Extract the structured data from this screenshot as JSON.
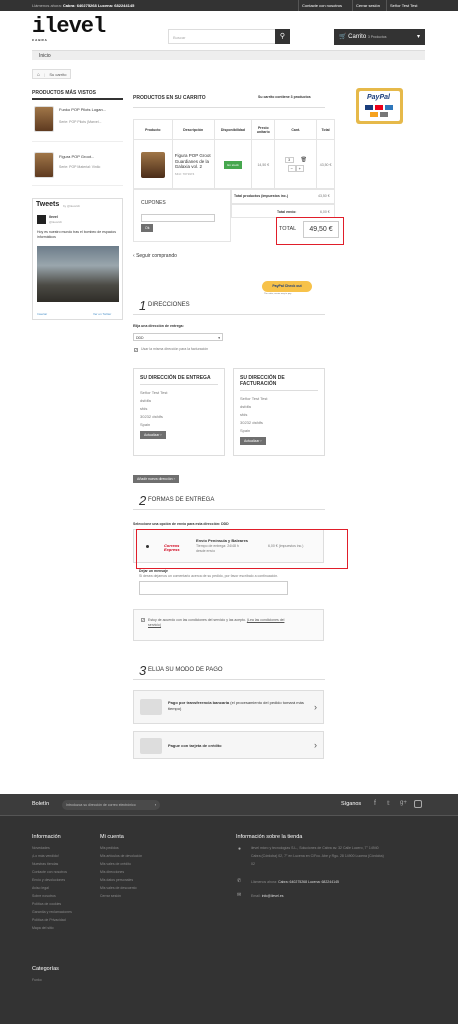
{
  "topbar": {
    "call_prefix": "Llámenos ahora:",
    "call_numbers": "Cabra: 640275268 Lucena: 682244145",
    "links": [
      "Contacte con nosotros",
      "Cerrar sesión",
      "Señor Test Test"
    ]
  },
  "header": {
    "logo_text": "ilevel",
    "logo_sub": "CABRA",
    "search_placeholder": "Buscar",
    "cart_label": "Carrito",
    "cart_count": "3 Productos"
  },
  "nav": {
    "home": "Inicio"
  },
  "breadcrumb": {
    "current": "Su carrito"
  },
  "sidebar": {
    "viewed_title": "PRODUCTOS MÁS VISTOS",
    "products": [
      {
        "name": "Funko POP Pilots Logan...",
        "desc": "Serie: POP Pilots (Marvel..."
      },
      {
        "name": "Figura POP Groot...",
        "desc": "Serie: POP Material: Vinilo"
      }
    ],
    "tweets": {
      "title": "Tweets",
      "by": "by @ilevelcb",
      "user": "ilevel",
      "handle": "@ilevelcb",
      "text": "Hoy es nuestro mundo tras el bombeo de espacios informáticos",
      "embed": "Insertar",
      "view_on": "Ver en Twitter"
    }
  },
  "cart": {
    "title": "PRODUCTOS EN SU CARRITO",
    "summary": "Su carrito contiene 3 productos",
    "headers": [
      "Producto",
      "Descripción",
      "Disponibilidad",
      "Precio unitario",
      "Cant.",
      "Total"
    ],
    "item": {
      "name": "Figura POP Groot Guardianes de la Galaxia vol. 2",
      "ref": "SKU: 7071974",
      "availability": "En stock",
      "unit_price": "14,50 €",
      "qty": "3",
      "total": "43,50 €"
    },
    "vouchers_label": "CUPONES",
    "voucher_btn": "Ok",
    "total_products_label": "Total productos (impuestos inc.)",
    "total_products": "43,50 €",
    "shipping_label": "Total envío:",
    "shipping": "6,00 €",
    "total_label": "TOTAL",
    "total": "49,50 €",
    "continue": "Seguir comprando",
    "paypal_checkout": "PayPal Check out",
    "paypal_sub": "The safer, easier way to pay"
  },
  "addresses": {
    "num": "1",
    "title": "DIRECCIONES",
    "select_label": "Elija una dirección de entrega:",
    "select_value": "DDD",
    "same_label": "Usar la misma dirección para la facturación",
    "delivery_title": "SU DIRECCIÓN DE ENTREGA",
    "billing_title": "SU DIRECCIÓN DE FACTURACIÓN",
    "lines": [
      "Señor Test Test",
      "dsfdfa",
      "sfds",
      "30232 dsfdfs",
      "Spain"
    ],
    "update_btn": "Actualizar",
    "add_btn": "Añadir nueva dirección"
  },
  "shipping": {
    "num": "2",
    "title": "FORMAS DE ENTREGA",
    "select_label": "Seleccione una opción de envío para esta dirección: DDD",
    "carrier_logo": "Correos Express",
    "carrier_name": "Envío Península y Baleares",
    "carrier_desc": "Tiempo de entrega: 24/48 h desde envío",
    "carrier_price": "6,00 € (impuestos inc.)",
    "message_title": "Dejar un mensaje",
    "message_hint": "Si desea dejarnos un comentario acerca de su pedido, por favor escríbalo a continuación.",
    "terms": "Estoy de acuerdo con las condiciones del servicio y las acepto.",
    "terms_link": "(Lea las condiciones del servicio)"
  },
  "payment": {
    "num": "3",
    "title": "ELIJA SU MODO DE PAGO",
    "option1_bold": "Pago por transferencia bancaria",
    "option1_rest": "(el procesamiento del pedido tomará más tiempo)",
    "option2": "Pague con tarjeta de crédito"
  },
  "paypal_badge": {
    "logo": "PayPal"
  },
  "footer": {
    "newsletter_label": "Boletín",
    "newsletter_placeholder": "Introduzca su dirección de correo electrónico",
    "follow": "Síganos",
    "info_title": "Información",
    "info_links": [
      "Novedades",
      "¡Lo más vendido!",
      "Nuestras tiendas",
      "Contacte con nosotros",
      "Envío y devoluciones",
      "Aviso legal",
      "Sobre nosotros",
      "Política de cookies",
      "Garantía y reclamaciones",
      "Política de Privacidad",
      "Mapa del sitio"
    ],
    "account_title": "Mi cuenta",
    "account_links": [
      "Mis pedidos",
      "Mis artículos de devolución",
      "Mis vales de crédito",
      "Mis direcciones",
      "Mis datos personales",
      "Mis vales de descuento",
      "Cerrar sesión"
    ],
    "store_title": "Información sobre la tienda",
    "store_address": "ilevel micro y tecnologías S.L., Soluciones de Cabra av. 32 Calle Lucero, 7° 14940 Cabra (Córdoba) 02, 7° en Lucena en C/Fco. Abe y Rgu. 28 14900 Lucena (Córdoba) 02",
    "store_phone_label": "Llámenos ahora:",
    "store_phone": "Cabra: 640275268 Lucena: 682244145",
    "store_email_label": "Email:",
    "store_email": "info@ilevel.es",
    "categories_title": "Categorías",
    "categories_links": [
      "Funko"
    ]
  },
  "colors": {
    "dark": "#333333",
    "red_highlight": "#e01e2a",
    "stock_green": "#46a74e"
  }
}
